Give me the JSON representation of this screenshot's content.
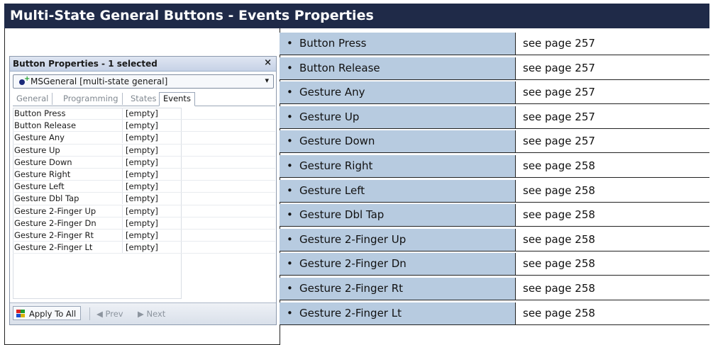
{
  "title": "Multi-State General Buttons - Events Properties",
  "panel": {
    "header": "Button Properties - 1 selected",
    "close_glyph": "×",
    "dropdown_value": "MSGeneral  [multi-state general]",
    "tabs": [
      "General",
      "Programming",
      "States",
      "Events"
    ],
    "rows": [
      {
        "name": "Button Press",
        "value": "[empty]"
      },
      {
        "name": "Button Release",
        "value": "[empty]"
      },
      {
        "name": "Gesture Any",
        "value": "[empty]"
      },
      {
        "name": "Gesture Up",
        "value": "[empty]"
      },
      {
        "name": "Gesture Down",
        "value": "[empty]"
      },
      {
        "name": "Gesture Right",
        "value": "[empty]"
      },
      {
        "name": "Gesture Left",
        "value": "[empty]"
      },
      {
        "name": "Gesture Dbl Tap",
        "value": "[empty]"
      },
      {
        "name": "Gesture 2-Finger Up",
        "value": "[empty]"
      },
      {
        "name": "Gesture 2-Finger Dn",
        "value": "[empty]"
      },
      {
        "name": "Gesture 2-Finger Rt",
        "value": "[empty]"
      },
      {
        "name": "Gesture 2-Finger Lt",
        "value": "[empty]"
      }
    ],
    "footer": {
      "apply": "Apply To All",
      "prev": "Prev",
      "next": "Next"
    }
  },
  "events": [
    {
      "name": "Button Press",
      "ref": "see page 257"
    },
    {
      "name": "Button Release",
      "ref": "see page 257"
    },
    {
      "name": "Gesture Any",
      "ref": "see page 257"
    },
    {
      "name": "Gesture Up",
      "ref": "see page 257"
    },
    {
      "name": "Gesture Down",
      "ref": "see page 257"
    },
    {
      "name": "Gesture Right",
      "ref": "see page 258"
    },
    {
      "name": "Gesture Left",
      "ref": "see page 258"
    },
    {
      "name": "Gesture Dbl Tap",
      "ref": "see page 258"
    },
    {
      "name": "Gesture 2-Finger Up",
      "ref": "see page 258"
    },
    {
      "name": "Gesture 2-Finger Dn",
      "ref": "see page 258"
    },
    {
      "name": "Gesture 2-Finger Rt",
      "ref": "see page 258"
    },
    {
      "name": "Gesture 2-Finger Lt",
      "ref": "see page 258"
    }
  ],
  "colors": {
    "title_bg": "#1f2a48",
    "event_cell_bg": "#b7cbe0"
  },
  "icons": {
    "bullet": "•",
    "panel_object": "object-add-icon",
    "dropdown": "chevron-down-icon",
    "apply": "apply-all-icon",
    "prev": "triangle-left-icon",
    "next": "triangle-right-icon"
  }
}
